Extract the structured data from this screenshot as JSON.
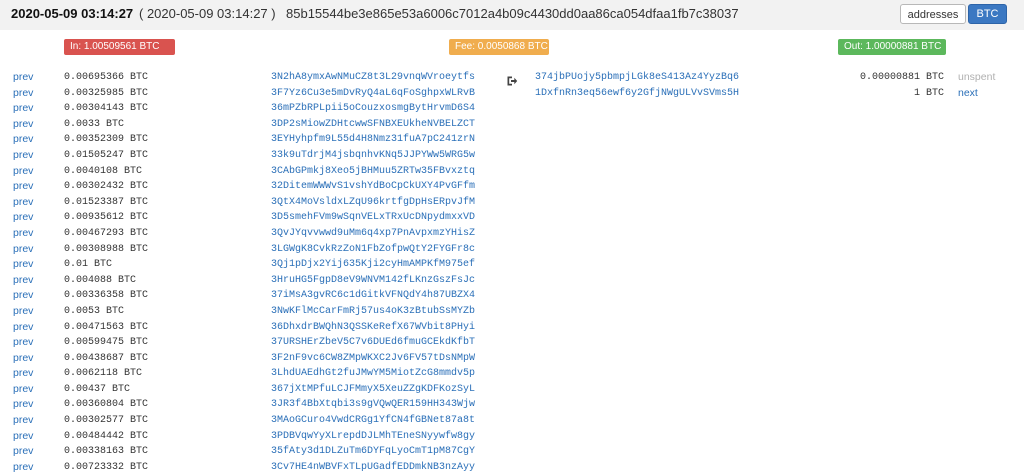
{
  "header": {
    "time": "2020-05-09 03:14:27",
    "time_paren": "( 2020-05-09 03:14:27 )",
    "hash": "85b15544be3e865e53a6006c7012a4b09c4430dd0aa86ca054dfaa1fb7c38037",
    "addresses_label": "addresses",
    "btc_label": "BTC"
  },
  "summary": {
    "in_label": "In: 1.00509561 BTC",
    "fee_label": "Fee: 0.0050868 BTC",
    "out_label": "Out: 1.00000881 BTC"
  },
  "inputs": [
    {
      "link": "prev",
      "value": "0.00695366 BTC",
      "address": "3N2hA8ymxAwNMuCZ8t3L29vnqWVroeytfs"
    },
    {
      "link": "prev",
      "value": "0.00325985 BTC",
      "address": "3F7Yz6Cu3e5mDvRyQ4aL6qFoSghpxWLRvB"
    },
    {
      "link": "prev",
      "value": "0.00304143 BTC",
      "address": "36mPZbRPLpii5oCouzxosmgBytHrvmD6S4"
    },
    {
      "link": "prev",
      "value": "0.0033 BTC",
      "address": "3DP2sMiowZDHtcwwSFNBXEUkheNVBELZCT"
    },
    {
      "link": "prev",
      "value": "0.00352309 BTC",
      "address": "3EYHyhpfm9L55d4H8Nmz31fuA7pC241zrN"
    },
    {
      "link": "prev",
      "value": "0.01505247 BTC",
      "address": "33k9uTdrjM4jsbqnhvKNq5JJPYWw5WRG5w"
    },
    {
      "link": "prev",
      "value": "0.0040108 BTC",
      "address": "3CAbGPmkj8Xeo5jBHMuu5ZRTw35FBvxztq"
    },
    {
      "link": "prev",
      "value": "0.00302432 BTC",
      "address": "32DitemWWWvS1vshYdBoCpCkUXY4PvGFfm"
    },
    {
      "link": "prev",
      "value": "0.01523387 BTC",
      "address": "3QtX4MoVsldxLZqU96krtfgDpHsERpvJfM"
    },
    {
      "link": "prev",
      "value": "0.00935612 BTC",
      "address": "3D5smehFVm9wSqnVELxTRxUcDNpydmxxVD"
    },
    {
      "link": "prev",
      "value": "0.00467293 BTC",
      "address": "3QvJYqvvwwd9uMm6q4xp7PnAvpxmzYHisZ"
    },
    {
      "link": "prev",
      "value": "0.00308988 BTC",
      "address": "3LGWgK8CvkRzZoN1FbZofpwQtY2FYGFr8c"
    },
    {
      "link": "prev",
      "value": "0.01 BTC",
      "address": "3Qj1pDjx2Yij635Kji2cyHmAMPKfM975ef"
    },
    {
      "link": "prev",
      "value": "0.004088 BTC",
      "address": "3HruHG5FgpD8eV9WNVM142fLKnzGszFsJc"
    },
    {
      "link": "prev",
      "value": "0.00336358 BTC",
      "address": "37iMsA3gvRC6c1dGitkVFNQdY4h87UBZX4"
    },
    {
      "link": "prev",
      "value": "0.0053 BTC",
      "address": "3NwKFlMcCarFmRj57us4oK3zBtubSsMYZb"
    },
    {
      "link": "prev",
      "value": "0.00471563 BTC",
      "address": "36DhxdrBWQhN3QSSKeRefX67WVbit8PHyi"
    },
    {
      "link": "prev",
      "value": "0.00599475 BTC",
      "address": "37URSHErZbeV5C7v6DUEd6fmuGCEkdKfbT"
    },
    {
      "link": "prev",
      "value": "0.00438687 BTC",
      "address": "3F2nF9vc6CW8ZMpWKXC2Jv6FV57tDsNMpW"
    },
    {
      "link": "prev",
      "value": "0.0062118 BTC",
      "address": "3LhdUAEdhGt2fuJMwYM5MiotZcG8mmdv5p"
    },
    {
      "link": "prev",
      "value": "0.00437 BTC",
      "address": "367jXtMPfuLCJFMmyX5XeuZZgKDFKozSyL"
    },
    {
      "link": "prev",
      "value": "0.00360804 BTC",
      "address": "3JR3f4BbXtqbi3s9gVQwQER159HH343Wjw"
    },
    {
      "link": "prev",
      "value": "0.00302577 BTC",
      "address": "3MAoGCuro4VwdCRGg1YfCN4fGBNet87a8t"
    },
    {
      "link": "prev",
      "value": "0.00484442 BTC",
      "address": "3PDBVqwYyXLrepdDJLMhTEneSNyywfw8gy"
    },
    {
      "link": "prev",
      "value": "0.00338163 BTC",
      "address": "35fAty3d1DLZuTm6DYFqLyoCmT1pM87CgY"
    },
    {
      "link": "prev",
      "value": "0.00723332 BTC",
      "address": "3Cv7HE4nWBVFxTLpUGadfEDDmkNB3nzAyy"
    }
  ],
  "outputs": [
    {
      "address": "374jbPUojy5pbmpjLGk8eS413Az4YyzBq6",
      "value": "0.00000881 BTC",
      "status": "unspent"
    },
    {
      "address": "1DxfnRn3eq56ewf6y2GfjNWgULVvSVms5H",
      "value": "1 BTC",
      "status": "next"
    }
  ],
  "icons": {
    "arrow": "arrow-right-from-bracket-icon"
  },
  "colors": {
    "link": "#2a6fb8",
    "in": "#d9534f",
    "fee": "#f0ad4e",
    "out": "#5cb85c",
    "accent": "#3b78c2"
  }
}
